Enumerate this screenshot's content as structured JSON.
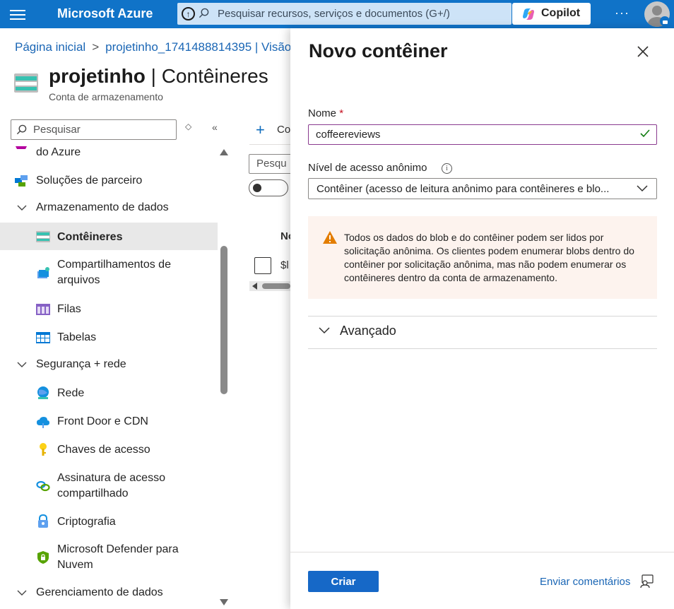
{
  "topbar": {
    "brand": "Microsoft Azure",
    "search_placeholder": "Pesquisar recursos, serviços e documentos (G+/)",
    "copilot_label": "Copilot",
    "more": "···"
  },
  "breadcrumb": {
    "home": "Página inicial",
    "separator": ">",
    "resource": "projetinho_1741488814395 | Visão"
  },
  "resource": {
    "name": "projetinho",
    "section": "| Contêineres",
    "type": "Conta de armazenamento"
  },
  "sidebar": {
    "search_placeholder": "Pesquisar",
    "items": [
      {
        "label": "do Azure"
      },
      {
        "label": "Soluções de parceiro"
      },
      {
        "label": "Armazenamento de dados"
      },
      {
        "label": "Contêineres"
      },
      {
        "label": "Compartilhamentos de arquivos"
      },
      {
        "label": "Filas"
      },
      {
        "label": "Tabelas"
      },
      {
        "label": "Segurança + rede"
      },
      {
        "label": "Rede"
      },
      {
        "label": "Front Door e CDN"
      },
      {
        "label": "Chaves de acesso"
      },
      {
        "label": "Assinatura de acesso compartilhado"
      },
      {
        "label": "Criptografia"
      },
      {
        "label": "Microsoft Defender para Nuvem"
      },
      {
        "label": "Gerenciamento de dados"
      }
    ]
  },
  "background": {
    "add_label": "Co",
    "filter_placeholder": "Pesqu",
    "column_header": "No",
    "row_value": "$l"
  },
  "panel": {
    "title": "Novo contêiner",
    "name_label": "Nome",
    "required_mark": "*",
    "name_value": "coffeereviews",
    "access_label": "Nível de acesso anônimo",
    "info_glyph": "i",
    "access_value": "Contêiner (acesso de leitura anônimo para contêineres e blo...",
    "warning_text": "Todos os dados do blob e do contêiner podem ser lidos por solicitação anônima. Os clientes podem enumerar blobs dentro do contêiner por solicitação anônima, mas não podem enumerar os contêineres dentro da conta de armazenamento.",
    "advanced_label": "Avançado",
    "create_label": "Criar",
    "feedback_label": "Enviar comentários"
  },
  "colors": {
    "topbar": "#1073c8",
    "accent": "#1668c7",
    "link": "#1a66b5",
    "warning_bg": "#fdf3ee",
    "warning_icon": "#e37d00",
    "success": "#107c10"
  }
}
